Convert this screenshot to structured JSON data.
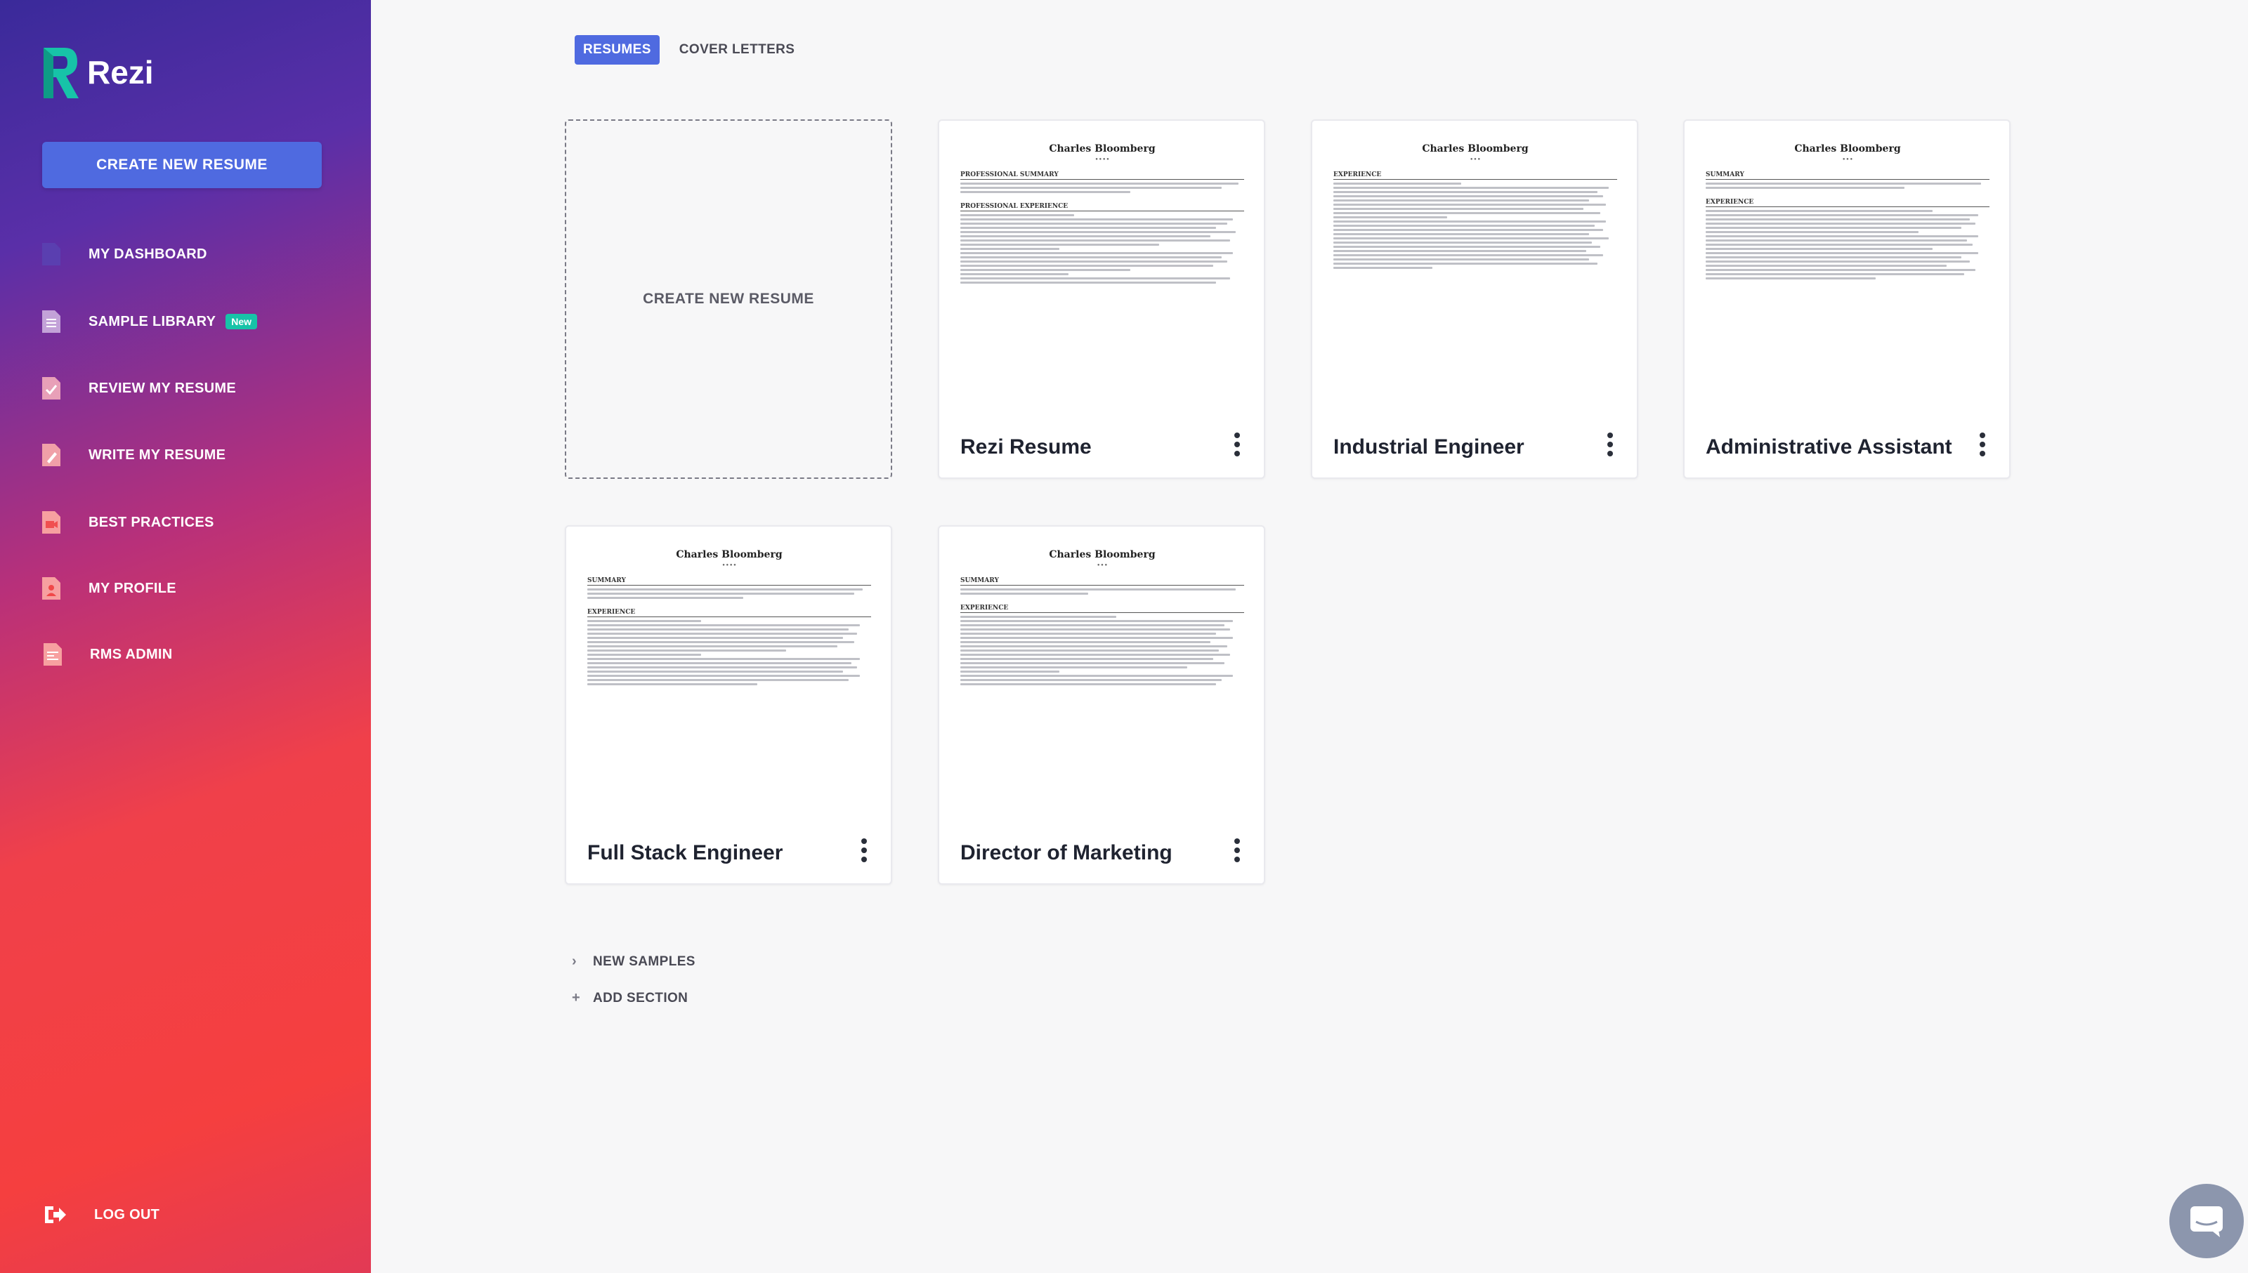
{
  "app": {
    "name": "Rezi"
  },
  "sidebar": {
    "create_button": "CREATE NEW RESUME",
    "items": [
      {
        "label": "MY DASHBOARD",
        "icon": "document-icon"
      },
      {
        "label": "SAMPLE LIBRARY",
        "icon": "list-document-icon",
        "badge": "New"
      },
      {
        "label": "REVIEW MY RESUME",
        "icon": "check-document-icon"
      },
      {
        "label": "WRITE MY RESUME",
        "icon": "pen-document-icon"
      },
      {
        "label": "BEST PRACTICES",
        "icon": "video-document-icon"
      },
      {
        "label": "MY PROFILE",
        "icon": "profile-document-icon"
      },
      {
        "label": "RMS ADMIN",
        "icon": "admin-document-icon"
      }
    ],
    "logout": "LOG OUT"
  },
  "tabs": {
    "active": "RESUMES",
    "other": "COVER LETTERS"
  },
  "new_resume_card": "CREATE NEW RESUME",
  "resumes": [
    {
      "title": "Rezi Resume",
      "name": "Charles Bloomberg",
      "sections": [
        "PROFESSIONAL SUMMARY",
        "PROFESSIONAL EXPERIENCE"
      ]
    },
    {
      "title": "Industrial Engineer",
      "name": "Charles Bloomberg",
      "sections": [
        "EXPERIENCE"
      ]
    },
    {
      "title": "Administrative Assistant",
      "name": "Charles Bloomberg",
      "sections": [
        "SUMMARY",
        "EXPERIENCE"
      ]
    },
    {
      "title": "Full Stack Engineer",
      "name": "Charles Bloomberg",
      "sections": [
        "SUMMARY",
        "EXPERIENCE"
      ]
    },
    {
      "title": "Director of Marketing",
      "name": "Charles Bloomberg",
      "sections": [
        "SUMMARY",
        "EXPERIENCE"
      ]
    }
  ],
  "sections": {
    "new_samples": "NEW SAMPLES",
    "add_section": "ADD SECTION"
  },
  "colors": {
    "accent": "#4f6ae0",
    "badge": "#17c3a8",
    "logo": "#17c3a8"
  }
}
